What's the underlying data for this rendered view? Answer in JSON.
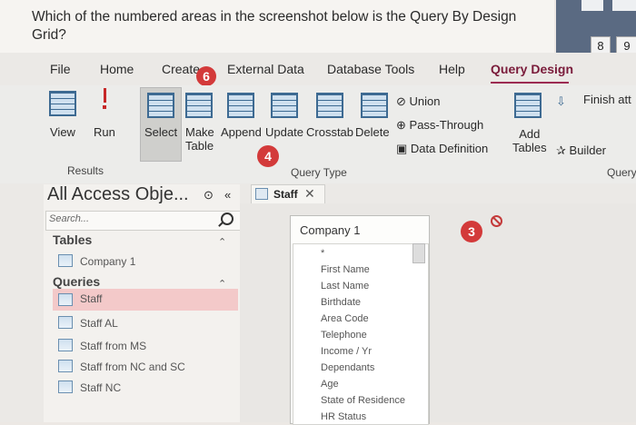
{
  "question": "Which of the numbered areas in the screenshot below is the Query By Design Grid?",
  "window_corner": {
    "btn_8": "8",
    "btn_9": "9"
  },
  "tabs": {
    "file": "File",
    "home": "Home",
    "create": "Create",
    "external": "External Data",
    "database_tools": "Database Tools",
    "help": "Help",
    "query_design": "Query Design"
  },
  "ribbon": {
    "view": "View",
    "run": "Run",
    "select": "Select",
    "make_table": "Make\nTable",
    "append": "Append",
    "update": "Update",
    "crosstab": "Crosstab",
    "delete": "Delete",
    "union": "Union",
    "pass_through": "Pass-Through",
    "data_definition": "Data Definition",
    "add_tables": "Add\nTables",
    "finish": "Finish att",
    "builder": "Builder",
    "results_group": "Results",
    "query_type_group": "Query Type",
    "query_group": "Query"
  },
  "badges": {
    "b6": "6",
    "b4": "4",
    "b3": "3"
  },
  "nav": {
    "title": "All Access Obje...",
    "search_placeholder": "Search...",
    "tables_label": "Tables",
    "tables": [
      "Company 1"
    ],
    "queries_label": "Queries",
    "queries": [
      "Staff",
      "Staff AL",
      "Staff from MS",
      "Staff from NC and SC",
      "Staff NC"
    ]
  },
  "document_tab": {
    "label": "Staff"
  },
  "table_box": {
    "title": "Company 1",
    "star": "*",
    "fields": [
      "First Name",
      "Last Name",
      "Birthdate",
      "Area Code",
      "Telephone",
      "Income / Yr",
      "Dependants",
      "Age",
      "State of Residence",
      "HR Status"
    ]
  }
}
